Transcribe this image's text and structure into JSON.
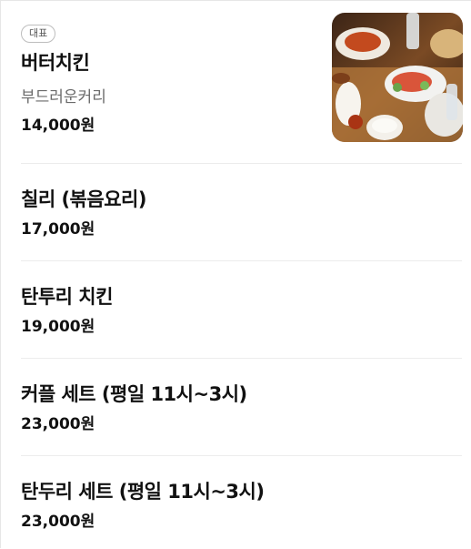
{
  "menu": {
    "items": [
      {
        "badge": "대표",
        "name": "버터치킨",
        "desc": "부드러운커리",
        "price": "14,000원"
      },
      {
        "name": "칠리 (볶음요리)",
        "price": "17,000원"
      },
      {
        "name": "탄투리 치킨",
        "price": "19,000원"
      },
      {
        "name": "커플 세트 (평일 11시~3시)",
        "price": "23,000원"
      },
      {
        "name": "탄두리 세트 (평일 11시~3시)",
        "price": "23,000원"
      }
    ]
  }
}
